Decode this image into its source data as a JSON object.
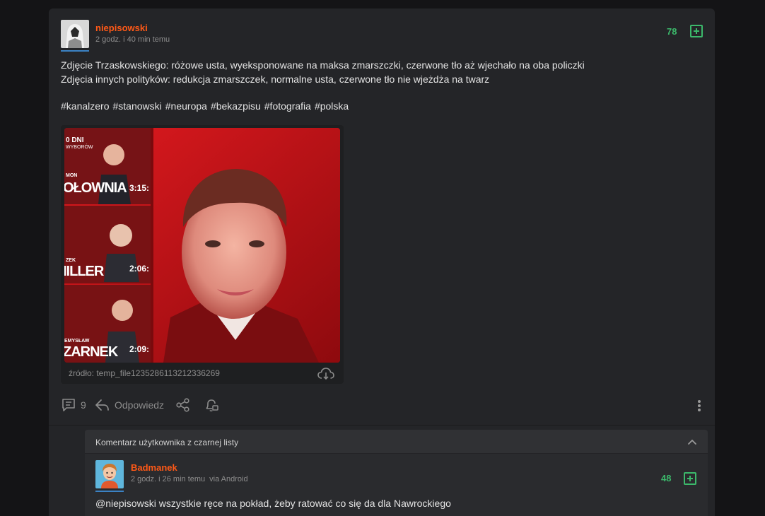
{
  "post": {
    "author": "niepisowski",
    "time": "2 godz. i 40 min temu",
    "votes": "78",
    "body_line1": "Zdjęcie Trzaskowskiego: różowe usta, wyeksponowane na maksa zmarszczki, czerwone tło aż wjechało na oba policzki",
    "body_line2": "Zdjęcia innych polityków: redukcja zmarszczek, normalne usta, czerwone tło nie wjeżdża na twarz",
    "tags": [
      "#kanalzero",
      "#stanowski",
      "#neuropa",
      "#bekazpisu",
      "#fotografia",
      "#polska"
    ],
    "image_source": "źródło: temp_file1235286113212336269",
    "thumbnail_texts": {
      "days": "0 DNI",
      "days_sub": "WYBORÓW",
      "name1_small": "MON",
      "name1": "OŁOWNIA",
      "time1": "3:15:",
      "name2_small": "ZEK",
      "name2": "IILLER",
      "time2": "2:06:",
      "name3_small": "EMYSŁAW",
      "name3": "ZARNEK",
      "time3": "2:09:"
    },
    "comments_count": "9",
    "reply_label": "Odpowiedz"
  },
  "comment": {
    "blacklist_label": "Komentarz użytkownika z czarnej listy",
    "author": "Badmanek",
    "time": "2 godz. i 26 min temu",
    "via": "via Android",
    "votes": "48",
    "mention": "@niepisowski",
    "text": " wszystkie ręce na pokład, żeby ratować co się da dla Nawrockiego"
  },
  "colors": {
    "author": "#ff5917",
    "votes": "#3cb96b",
    "card": "#242528",
    "background": "#141416"
  }
}
